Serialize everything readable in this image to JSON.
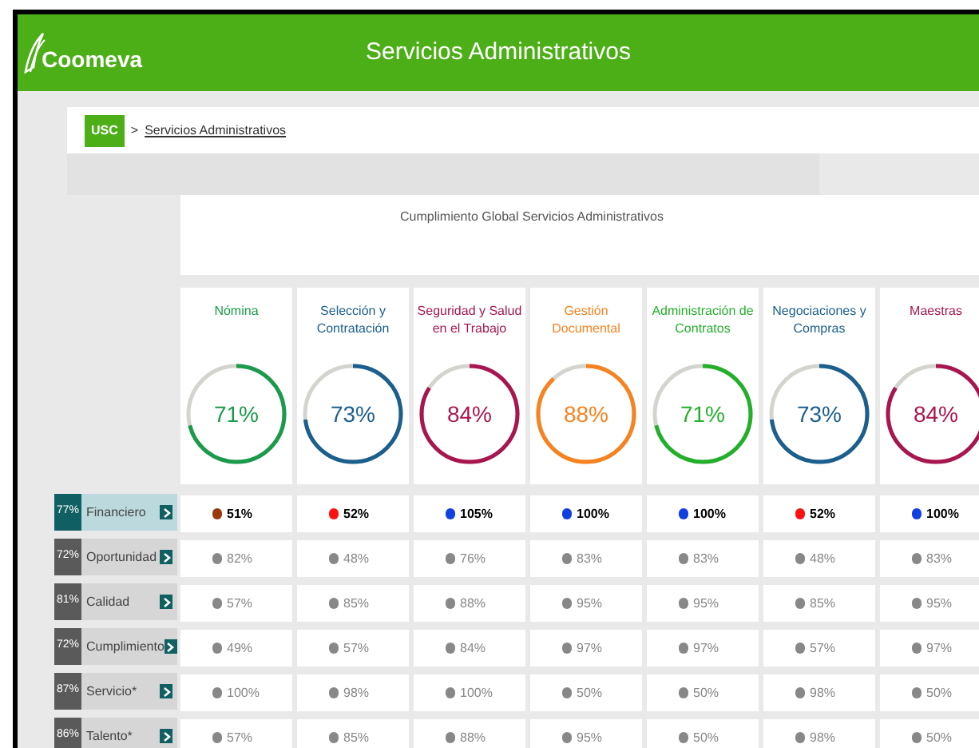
{
  "header": {
    "logo": "Coomeva",
    "title": "Servicios Administrativos"
  },
  "breadcrumb": {
    "home": "USC",
    "separator": ">",
    "current": "Servicios Administrativos"
  },
  "panel_title": "Cumplimiento Global Servicios Administrativos",
  "columns": [
    {
      "title": "Nómina",
      "percent": "71%",
      "color": "#1a9a4a"
    },
    {
      "title": "Selección y Contratación",
      "percent": "73%",
      "color": "#1a5f8e"
    },
    {
      "title": "Seguridad y Salud en el Trabajo",
      "percent": "84%",
      "color": "#a8164f"
    },
    {
      "title": "Gestión Documental",
      "percent": "88%",
      "color": "#f7821e"
    },
    {
      "title": "Administración de Contratos",
      "percent": "71%",
      "color": "#22b02a"
    },
    {
      "title": "Negociaciones y Compras",
      "percent": "73%",
      "color": "#1a5f8e"
    },
    {
      "title": "Maestras",
      "percent": "84%",
      "color": "#a8164f"
    }
  ],
  "rows": [
    {
      "score": "77%",
      "label": "Financiero",
      "selected": true,
      "values": [
        {
          "text": "51%",
          "color": "#9a3a0a"
        },
        {
          "text": "52%",
          "color": "#ff1010"
        },
        {
          "text": "105%",
          "color": "#1040e0"
        },
        {
          "text": "100%",
          "color": "#1040e0"
        },
        {
          "text": "100%",
          "color": "#1040e0"
        },
        {
          "text": "52%",
          "color": "#ff1010"
        },
        {
          "text": "100%",
          "color": "#1040e0"
        }
      ]
    },
    {
      "score": "72%",
      "label": "Oportunidad",
      "selected": false,
      "values": [
        {
          "text": "82%",
          "color": "#888888"
        },
        {
          "text": "48%",
          "color": "#888888"
        },
        {
          "text": "76%",
          "color": "#888888"
        },
        {
          "text": "83%",
          "color": "#888888"
        },
        {
          "text": "83%",
          "color": "#888888"
        },
        {
          "text": "48%",
          "color": "#888888"
        },
        {
          "text": "83%",
          "color": "#888888"
        }
      ]
    },
    {
      "score": "81%",
      "label": "Calidad",
      "selected": false,
      "values": [
        {
          "text": "57%",
          "color": "#888888"
        },
        {
          "text": "85%",
          "color": "#888888"
        },
        {
          "text": "88%",
          "color": "#888888"
        },
        {
          "text": "95%",
          "color": "#888888"
        },
        {
          "text": "95%",
          "color": "#888888"
        },
        {
          "text": "85%",
          "color": "#888888"
        },
        {
          "text": "95%",
          "color": "#888888"
        }
      ]
    },
    {
      "score": "72%",
      "label": "Cumplimiento",
      "selected": false,
      "values": [
        {
          "text": "49%",
          "color": "#888888"
        },
        {
          "text": "57%",
          "color": "#888888"
        },
        {
          "text": "84%",
          "color": "#888888"
        },
        {
          "text": "97%",
          "color": "#888888"
        },
        {
          "text": "97%",
          "color": "#888888"
        },
        {
          "text": "57%",
          "color": "#888888"
        },
        {
          "text": "97%",
          "color": "#888888"
        }
      ]
    },
    {
      "score": "87%",
      "label": "Servicio*",
      "selected": false,
      "values": [
        {
          "text": "100%",
          "color": "#888888"
        },
        {
          "text": "98%",
          "color": "#888888"
        },
        {
          "text": "100%",
          "color": "#888888"
        },
        {
          "text": "50%",
          "color": "#888888"
        },
        {
          "text": "50%",
          "color": "#888888"
        },
        {
          "text": "98%",
          "color": "#888888"
        },
        {
          "text": "50%",
          "color": "#888888"
        }
      ]
    },
    {
      "score": "86%",
      "label": "Talento*",
      "selected": false,
      "values": [
        {
          "text": "57%",
          "color": "#888888"
        },
        {
          "text": "85%",
          "color": "#888888"
        },
        {
          "text": "88%",
          "color": "#888888"
        },
        {
          "text": "95%",
          "color": "#888888"
        },
        {
          "text": "50%",
          "color": "#888888"
        },
        {
          "text": "98%",
          "color": "#888888"
        },
        {
          "text": "50%",
          "color": "#888888"
        }
      ]
    }
  ]
}
